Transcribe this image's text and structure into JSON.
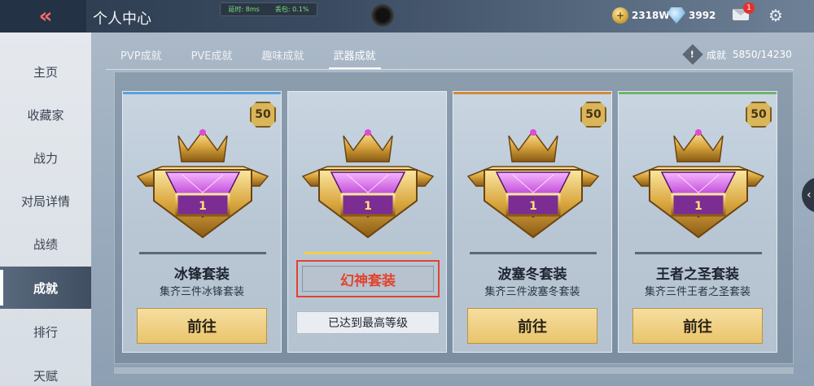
{
  "header": {
    "title": "个人中心",
    "net": {
      "latency": "延时: 8ms",
      "loss": "丢包: 0.1%"
    },
    "gold": "2318W",
    "diamond": "3992",
    "mail_badge": "1"
  },
  "sidebar": {
    "items": [
      {
        "label": "主页"
      },
      {
        "label": "收藏家"
      },
      {
        "label": "战力"
      },
      {
        "label": "对局详情"
      },
      {
        "label": "战绩"
      },
      {
        "label": "成就"
      },
      {
        "label": "排行"
      },
      {
        "label": "天赋"
      }
    ],
    "active_index": 5
  },
  "tabs": [
    {
      "label": "PVP成就"
    },
    {
      "label": "PVE成就"
    },
    {
      "label": "趣味成就"
    },
    {
      "label": "武器成就"
    }
  ],
  "achievement": {
    "label": "成就",
    "progress": "5850/14230"
  },
  "cards": [
    {
      "level": "50",
      "rank": "1",
      "name": "冰锋套装",
      "desc": "集齐三件冰锋套装",
      "button": "前往",
      "accent": "#5aa0dc"
    },
    {
      "level": "",
      "rank": "1",
      "name": "幻神套装",
      "status": "已达到最高等级",
      "accent": "#f2cf45"
    },
    {
      "level": "50",
      "rank": "1",
      "name": "波塞冬套装",
      "desc": "集齐三件波塞冬套装",
      "button": "前往",
      "accent": "#d28a3a"
    },
    {
      "level": "50",
      "rank": "1",
      "name": "王者之圣套装",
      "desc": "集齐三件王者之圣套装",
      "button": "前往",
      "accent": "#6fb36b"
    }
  ]
}
